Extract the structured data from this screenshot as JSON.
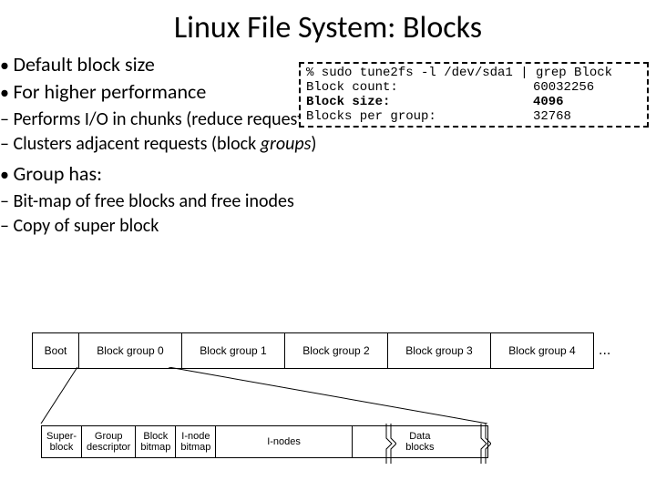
{
  "title": "Linux File System: Blocks",
  "bullets": {
    "b1": "Default block size",
    "b2": "For higher performance",
    "b2a": "Performs I/O in chunks (reduce requests)",
    "b2b_pre": "Clusters adjacent requests (block ",
    "b2b_it": "groups",
    "b2b_post": ")",
    "b3": "Group has:",
    "b3a": "Bit-map of  free blocks  and free inodes",
    "b3b": "Copy of super block"
  },
  "code": {
    "cmd": "% sudo tune2fs -l /dev/sda1 | grep Block",
    "r1k": "Block count:",
    "r1v": "60032256",
    "r2k": "Block size:",
    "r2v": "4096",
    "r3k": "Blocks per group:",
    "r3v": "32768"
  },
  "row1": {
    "c0": "Boot",
    "c1": "Block group 0",
    "c2": "Block group 1",
    "c3": "Block group 2",
    "c4": "Block group 3",
    "c5": "Block group 4",
    "dots": "..."
  },
  "row2": {
    "c0": "Super-\nblock",
    "c1": "Group\ndescriptor",
    "c2": "Block\nbitmap",
    "c3": "I-node\nbitmap",
    "c4": "I-nodes",
    "c5": "Data\nblocks"
  }
}
